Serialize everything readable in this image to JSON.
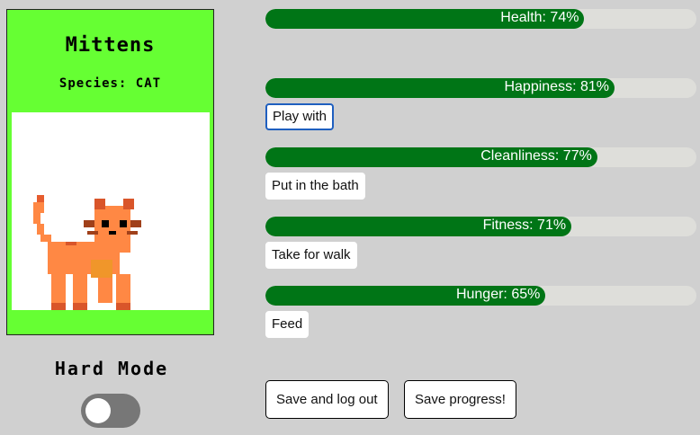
{
  "pet": {
    "name": "Mittens",
    "species": "Species: CAT"
  },
  "mode": {
    "label": "Hard Mode",
    "enabled": false
  },
  "stats": [
    {
      "key": "health",
      "label": "Health: 74%",
      "value": 74
    },
    {
      "key": "happiness",
      "label": "Happiness: 81%",
      "value": 81,
      "action": "Play with"
    },
    {
      "key": "cleanliness",
      "label": "Cleanliness: 77%",
      "value": 77,
      "action": "Put in the bath"
    },
    {
      "key": "fitness",
      "label": "Fitness: 71%",
      "value": 71,
      "action": "Take for walk"
    },
    {
      "key": "hunger",
      "label": "Hunger: 65%",
      "value": 65,
      "action": "Feed"
    }
  ],
  "footer": {
    "save_logout": "Save and log out",
    "save_progress": "Save progress!"
  },
  "colors": {
    "card_bg": "#66ff33",
    "bar_fill": "#007516",
    "bar_track": "#dededa",
    "page_bg": "#d0d0d0"
  }
}
